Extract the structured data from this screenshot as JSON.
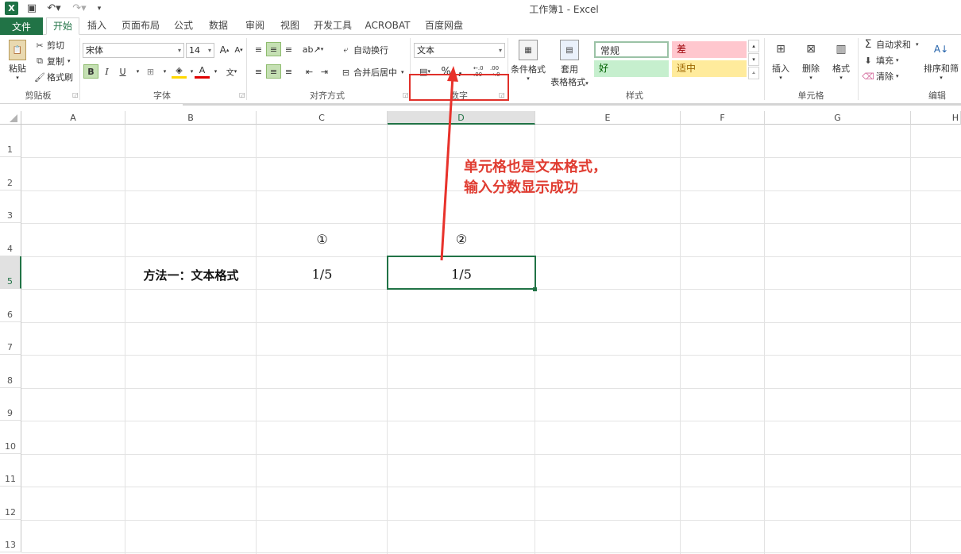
{
  "window": {
    "title": "工作簿1 - Excel"
  },
  "tabs": [
    "文件",
    "开始",
    "插入",
    "页面布局",
    "公式",
    "数据",
    "审阅",
    "视图",
    "开发工具",
    "ACROBAT",
    "百度网盘"
  ],
  "ribbon": {
    "clipboard": {
      "paste": "粘贴",
      "cut": "剪切",
      "copy": "复制",
      "format_painter": "格式刷",
      "label": "剪贴板"
    },
    "font": {
      "name": "宋体",
      "size": "14",
      "bold": "B",
      "italic": "I",
      "underline": "U",
      "label": "字体",
      "grow": "A",
      "shrink": "A",
      "font_color": "A",
      "phonetic": "文"
    },
    "alignment": {
      "wrap": "自动换行",
      "merge": "合并后居中",
      "label": "对齐方式"
    },
    "number": {
      "format": "文本",
      "percent": "%",
      "comma": ",",
      "inc": "←.0 .00",
      "dec": ".00 →.0",
      "label": "数字"
    },
    "styles": {
      "conditional": "条件格式",
      "table1": "套用",
      "table2": "表格格式",
      "normal": "常规",
      "bad": "差",
      "good": "好",
      "neutral": "适中",
      "label": "样式"
    },
    "cells": {
      "insert": "插入",
      "delete": "删除",
      "format": "格式",
      "label": "单元格"
    },
    "editing": {
      "autosum": "自动求和",
      "fill": "填充",
      "clear": "清除",
      "sort": "排序和筛",
      "label": "编辑"
    }
  },
  "sheet": {
    "columns": [
      "A",
      "B",
      "C",
      "D",
      "E",
      "F",
      "G",
      "H"
    ],
    "rows": [
      "1",
      "2",
      "3",
      "4",
      "5",
      "6",
      "7",
      "8",
      "9",
      "10",
      "11",
      "12",
      "13"
    ],
    "cells": {
      "C4": "①",
      "D4": "②",
      "B5": "方法一：文本格式",
      "C5": "1/5",
      "D5": "1/5"
    }
  },
  "annotation": {
    "line1": "单元格也是文本格式，",
    "line2": "输入分数显示成功"
  },
  "colors": {
    "excel_green": "#217346",
    "annotation_red": "#e03c31",
    "good_fill": "#c6efce",
    "bad_fill": "#ffc7ce",
    "neutral_fill": "#ffeb9c"
  }
}
